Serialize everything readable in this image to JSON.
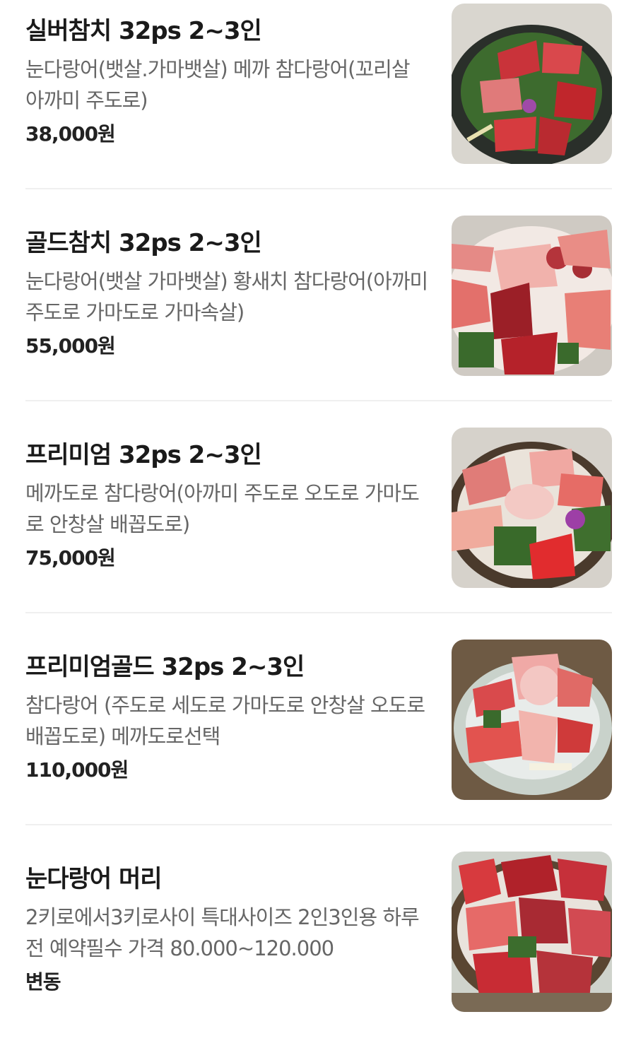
{
  "menu": {
    "items": [
      {
        "name": "실버참치 32ps 2~3인",
        "description": "눈다랑어(뱃살.가마뱃살) 메까 참다랑어(꼬리살 아까미 주도로)",
        "price": "38,000원",
        "image_icon": "tuna-sashimi-platter-photo"
      },
      {
        "name": "골드참치 32ps 2~3인",
        "description": "눈다랑어(뱃살 가마뱃살) 황새치 참다랑어(아까미 주도로 가마도로 가마속살)",
        "price": "55,000원",
        "image_icon": "tuna-sashimi-platter-photo"
      },
      {
        "name": "프리미엄 32ps 2~3인",
        "description": "메까도로 참다랑어(아까미 주도로 오도로 가마도로 안창살 배꼽도로)",
        "price": "75,000원",
        "image_icon": "tuna-sashimi-platter-photo"
      },
      {
        "name": "프리미엄골드 32ps 2~3인",
        "description": "참다랑어 (주도로 세도로 가마도로 안창살 오도로 배꼽도로) 메까도로선택",
        "price": "110,000원",
        "image_icon": "tuna-sashimi-platter-photo"
      },
      {
        "name": "눈다랑어 머리",
        "description": "2키로에서3키로사이 특대사이즈 2인3인용 하루전 예약필수 가격 80.000~120.000",
        "price": "변동",
        "image_icon": "tuna-head-platter-photo"
      }
    ]
  },
  "colors": {
    "name": "#1a1a1a",
    "description": "#666666",
    "price": "#222222",
    "divider": "#efefef",
    "background": "#ffffff"
  }
}
